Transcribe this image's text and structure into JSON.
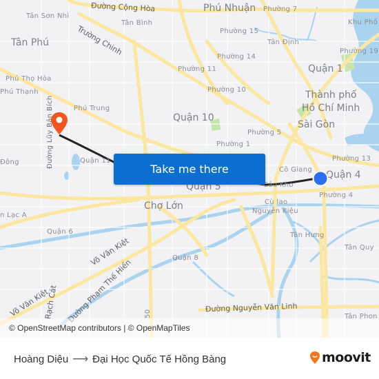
{
  "map": {
    "labels": {
      "duong_cong_hoa": "Đường Cộng Hòa",
      "tan_son_nhi": "Tân Sơn Nhì",
      "truong_chinh": "Trường Chinh",
      "tan_binh": "Tân Bình",
      "tan_phu": "Tân Phú",
      "phu_tho_hoa": "Phú Thọ Hòa",
      "phu_thanh": "Phú Thạnh",
      "phu_nhuan": "Phú Nhuận",
      "phuong_7": "Phường 7",
      "phuong_15": "Phường 15",
      "tan_dinh": "Tân Định",
      "khu_pho": "Khu Phố",
      "phuong_19": "Phường 19",
      "phuong_14": "Phường 14",
      "phuong_11": "Phường 11",
      "phuong_10": "Phường 10",
      "quan_1": "Quận 1",
      "thanh_pho": "Thành phố",
      "ho_chi_minh": "Hồ Chí Minh",
      "sai_gon": "Sài Gòn",
      "phu_trung": "Phú Trung",
      "duong_luy_ban_bich": "Đường Lũy Bán Bích",
      "dong": "Đông",
      "quan_11": "Quận 11",
      "quan_10": "Quận 10",
      "phuong_5": "Phường 5",
      "phuong_1": "Phường 1",
      "phuong_13": "Phường 13",
      "co_giang": "Cô Giang",
      "quan_4": "Quận 4",
      "quan_5": "Quận 5",
      "cau_kho": "Cầu Kho",
      "phuong_4": "Phường 4",
      "cho_lon": "Chợ Lớn",
      "cu_lao": "Cù lao",
      "nguyen_kieu": "Nguyễn Kiệu",
      "an_lac_a": "n Lạc A",
      "quan_6": "Quận 6",
      "vo_van_kiet_1": "Võ Văn Kiệt",
      "vo_van_kiet_2": "Võ Văn Kiệt",
      "duong_pham_the_hien": "Đường Phạm Thế Hiển",
      "rach_cat": "Rạch Cát",
      "quan_8": "Quận 8",
      "tan_hung": "Tân Hưng",
      "tan_quy": "Tân Quy",
      "duong_nguyen_van_linh": "Đường Nguyễn Văn Linh",
      "tan_phong": "Tân Phon",
      "road_50": "50"
    },
    "origin_marker": "orange-pin",
    "destination_marker": "blue-dot",
    "colors": {
      "origin": "#f0561d",
      "destination": "#2d6ff0",
      "route": "#222222",
      "water": "#aad3f0",
      "park": "#c5e5a9",
      "major_road": "#fce7a0"
    },
    "attribution": "© OpenStreetMap contributors | © OpenMapTiles"
  },
  "cta": {
    "label": "Take me there"
  },
  "footer": {
    "from": "Hoàng Diệu",
    "arrow": "⟶",
    "to": "Đại Học Quốc Tế Hồng Bàng",
    "brand": "moovit"
  }
}
